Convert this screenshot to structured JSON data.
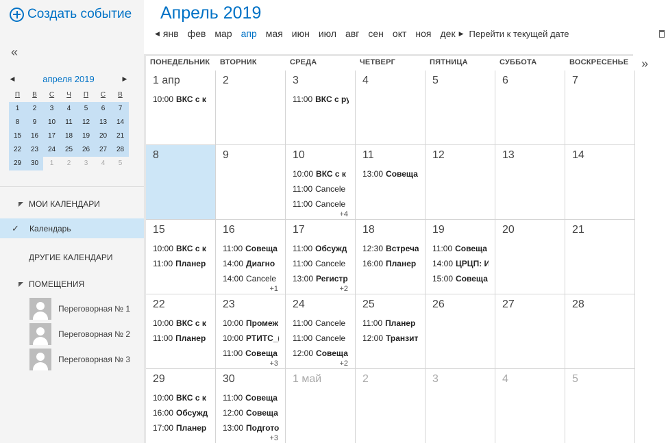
{
  "sidebar": {
    "create_event": "Создать событие",
    "collapse": "«",
    "mini_calendar": {
      "title": "апреля 2019",
      "prev": "◀",
      "next": "▶",
      "dow": [
        "П",
        "В",
        "С",
        "Ч",
        "П",
        "С",
        "В"
      ],
      "weeks": [
        [
          {
            "d": "1",
            "cur": true
          },
          {
            "d": "2",
            "cur": true
          },
          {
            "d": "3",
            "cur": true
          },
          {
            "d": "4",
            "cur": true
          },
          {
            "d": "5",
            "cur": true
          },
          {
            "d": "6",
            "cur": true
          },
          {
            "d": "7",
            "cur": true
          }
        ],
        [
          {
            "d": "8",
            "cur": true
          },
          {
            "d": "9",
            "cur": true
          },
          {
            "d": "10",
            "cur": true
          },
          {
            "d": "11",
            "cur": true
          },
          {
            "d": "12",
            "cur": true
          },
          {
            "d": "13",
            "cur": true
          },
          {
            "d": "14",
            "cur": true
          }
        ],
        [
          {
            "d": "15",
            "cur": true
          },
          {
            "d": "16",
            "cur": true
          },
          {
            "d": "17",
            "cur": true
          },
          {
            "d": "18",
            "cur": true
          },
          {
            "d": "19",
            "cur": true
          },
          {
            "d": "20",
            "cur": true
          },
          {
            "d": "21",
            "cur": true
          }
        ],
        [
          {
            "d": "22",
            "cur": false
          },
          {
            "d": "23",
            "cur": false
          },
          {
            "d": "24",
            "cur": false
          },
          {
            "d": "25",
            "cur": false
          },
          {
            "d": "26",
            "cur": false
          },
          {
            "d": "27",
            "cur": false
          },
          {
            "d": "28",
            "cur": false
          }
        ],
        [
          {
            "d": "29",
            "cur": true
          },
          {
            "d": "30",
            "cur": true
          },
          {
            "d": "1",
            "cur": false,
            "other": true
          },
          {
            "d": "2",
            "cur": false,
            "other": true
          },
          {
            "d": "3",
            "cur": false,
            "other": true
          },
          {
            "d": "4",
            "cur": false,
            "other": true
          },
          {
            "d": "5",
            "cur": false,
            "other": true
          }
        ]
      ]
    },
    "my_calendars": "МОИ КАЛЕНДАРИ",
    "calendar_item": "Календарь",
    "check": "✓",
    "other_calendars": "ДРУГИЕ КАЛЕНДАРИ",
    "rooms_label": "ПОМЕЩЕНИЯ",
    "rooms": [
      "Переговорная № 1",
      "Переговорная № 2",
      "Переговорная № 3"
    ]
  },
  "header": {
    "title": "Апрель 2019",
    "prev": "◀",
    "next": "▶",
    "months": [
      "янв",
      "фев",
      "мар",
      "апр",
      "мая",
      "июн",
      "июл",
      "авг",
      "сен",
      "окт",
      "ноя",
      "дек"
    ],
    "active_month": "апр",
    "go_today": "Перейти к текущей дате",
    "expand": "»"
  },
  "grid": {
    "dow": [
      "ПОНЕДЕЛЬНИК",
      "ВТОРНИК",
      "СРЕДА",
      "ЧЕТВЕРГ",
      "ПЯТНИЦА",
      "СУББОТА",
      "ВОСКРЕСЕНЬЕ"
    ],
    "weeks": [
      [
        {
          "num": "1 апр",
          "events": [
            {
              "t": "10:00",
              "s": "ВКС с к"
            }
          ]
        },
        {
          "num": "2",
          "events": []
        },
        {
          "num": "3",
          "events": [
            {
              "t": "11:00",
              "s": "ВКС с ру"
            }
          ]
        },
        {
          "num": "4",
          "events": []
        },
        {
          "num": "5",
          "events": []
        },
        {
          "num": "6",
          "events": []
        },
        {
          "num": "7",
          "events": []
        }
      ],
      [
        {
          "num": "8",
          "selected": true,
          "events": []
        },
        {
          "num": "9",
          "events": []
        },
        {
          "num": "10",
          "events": [
            {
              "t": "10:00",
              "s": "ВКС с к"
            },
            {
              "t": "11:00",
              "s": "Cancele",
              "plain": true
            },
            {
              "t": "11:00",
              "s": "Cancele",
              "plain": true
            }
          ],
          "more": "+4"
        },
        {
          "num": "11",
          "events": [
            {
              "t": "13:00",
              "s": "Совеща"
            }
          ]
        },
        {
          "num": "12",
          "events": []
        },
        {
          "num": "13",
          "events": []
        },
        {
          "num": "14",
          "events": []
        }
      ],
      [
        {
          "num": "15",
          "events": [
            {
              "t": "10:00",
              "s": "ВКС с к"
            },
            {
              "t": "11:00",
              "s": "Планер"
            }
          ]
        },
        {
          "num": "16",
          "events": [
            {
              "t": "11:00",
              "s": "Совеща"
            },
            {
              "t": "14:00",
              "s": "Диагно"
            },
            {
              "t": "14:00",
              "s": "Cancele",
              "plain": true
            }
          ],
          "more": "+1"
        },
        {
          "num": "17",
          "events": [
            {
              "t": "11:00",
              "s": "Обсужд"
            },
            {
              "t": "11:00",
              "s": "Cancele",
              "plain": true
            },
            {
              "t": "13:00",
              "s": "Регистр"
            }
          ],
          "more": "+2"
        },
        {
          "num": "18",
          "events": [
            {
              "t": "12:30",
              "s": "Встреча"
            },
            {
              "t": "16:00",
              "s": "Планер"
            }
          ]
        },
        {
          "num": "19",
          "events": [
            {
              "t": "11:00",
              "s": "Совеща"
            },
            {
              "t": "14:00",
              "s": "ЦРЦП: И"
            },
            {
              "t": "15:00",
              "s": "Совеща"
            }
          ]
        },
        {
          "num": "20",
          "events": []
        },
        {
          "num": "21",
          "events": []
        }
      ],
      [
        {
          "num": "22",
          "events": [
            {
              "t": "10:00",
              "s": "ВКС с к"
            },
            {
              "t": "11:00",
              "s": "Планер"
            }
          ]
        },
        {
          "num": "23",
          "events": [
            {
              "t": "10:00",
              "s": "Промеж"
            },
            {
              "t": "10:00",
              "s": "РТИТС_("
            },
            {
              "t": "11:00",
              "s": "Совеща"
            }
          ],
          "more": "+3"
        },
        {
          "num": "24",
          "events": [
            {
              "t": "11:00",
              "s": "Cancele",
              "plain": true
            },
            {
              "t": "11:00",
              "s": "Cancele",
              "plain": true
            },
            {
              "t": "12:00",
              "s": "Совеща"
            }
          ],
          "more": "+2"
        },
        {
          "num": "25",
          "events": [
            {
              "t": "11:00",
              "s": "Планер"
            },
            {
              "t": "12:00",
              "s": "Транзит"
            }
          ]
        },
        {
          "num": "26",
          "events": []
        },
        {
          "num": "27",
          "events": []
        },
        {
          "num": "28",
          "events": []
        }
      ],
      [
        {
          "num": "29",
          "events": [
            {
              "t": "10:00",
              "s": "ВКС с к"
            },
            {
              "t": "16:00",
              "s": "Обсужд"
            },
            {
              "t": "17:00",
              "s": "Планер"
            }
          ]
        },
        {
          "num": "30",
          "events": [
            {
              "t": "11:00",
              "s": "Совеща"
            },
            {
              "t": "12:00",
              "s": "Совеща"
            },
            {
              "t": "13:00",
              "s": "Подгото"
            }
          ],
          "more": "+3"
        },
        {
          "num": "1 май",
          "other": true,
          "events": []
        },
        {
          "num": "2",
          "other": true,
          "events": []
        },
        {
          "num": "3",
          "other": true,
          "events": []
        },
        {
          "num": "4",
          "other": true,
          "events": []
        },
        {
          "num": "5",
          "other": true,
          "events": []
        }
      ]
    ]
  }
}
